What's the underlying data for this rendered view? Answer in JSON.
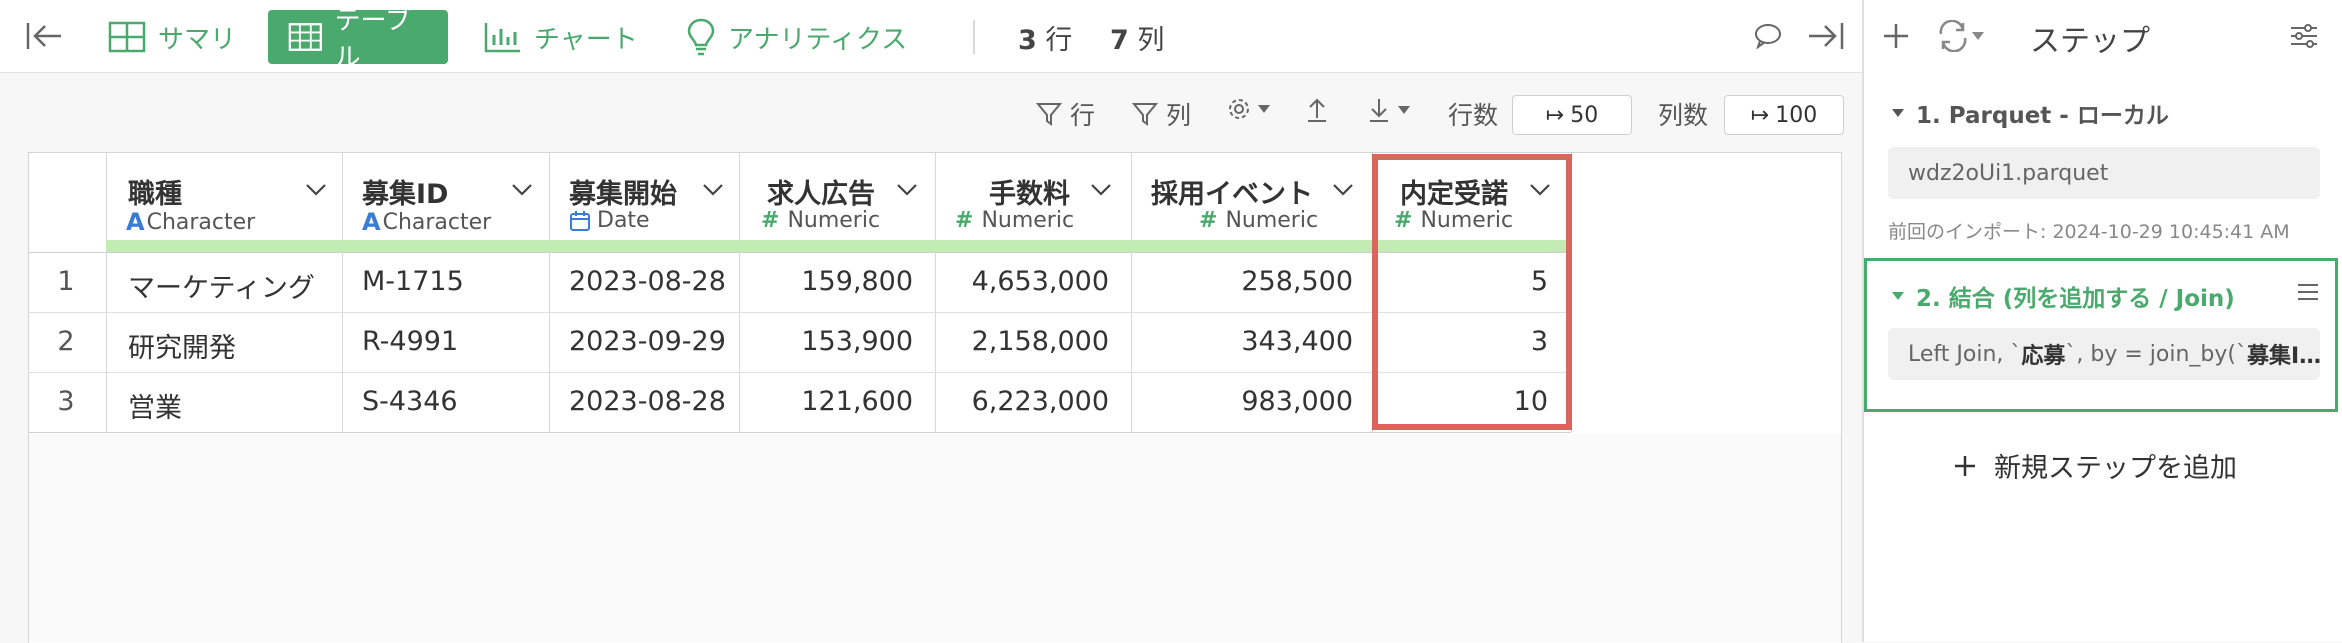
{
  "toolbar": {
    "summary_label": "サマリ",
    "table_label": "テーブル",
    "chart_label": "チャート",
    "analytics_label": "アナリティクス",
    "row_count": "3",
    "row_unit": "行",
    "col_count": "7",
    "col_unit": "列"
  },
  "subtoolbar": {
    "filter_rows": "行",
    "filter_cols": "列",
    "rows_label": "行数",
    "rows_value": "50",
    "cols_label": "列数",
    "cols_value": "100"
  },
  "columns": [
    {
      "name": "職種",
      "type": "Character",
      "type_icon": "character-icon"
    },
    {
      "name": "募集ID",
      "type": "Character",
      "type_icon": "character-icon"
    },
    {
      "name": "募集開始",
      "type": "Date",
      "type_icon": "calendar-icon"
    },
    {
      "name": "求人広告",
      "type": "Numeric",
      "type_icon": "hash-icon"
    },
    {
      "name": "手数料",
      "type": "Numeric",
      "type_icon": "hash-icon"
    },
    {
      "name": "採用イベント",
      "type": "Numeric",
      "type_icon": "hash-icon"
    },
    {
      "name": "内定受諾",
      "type": "Numeric",
      "type_icon": "hash-icon"
    }
  ],
  "rows": [
    {
      "n": "1",
      "c": [
        "マーケティング",
        "M-1715",
        "2023-08-28",
        "159,800",
        "4,653,000",
        "258,500",
        "5"
      ]
    },
    {
      "n": "2",
      "c": [
        "研究開発",
        "R-4991",
        "2023-09-29",
        "153,900",
        "2,158,000",
        "343,400",
        "3"
      ]
    },
    {
      "n": "3",
      "c": [
        "営業",
        "S-4346",
        "2023-08-28",
        "121,600",
        "6,223,000",
        "983,000",
        "10"
      ]
    }
  ],
  "panel": {
    "title": "ステップ",
    "step1": {
      "title": "1. Parquet - ローカル",
      "file": "wdz2oUi1.parquet",
      "meta": "前回のインポート: 2024-10-29 10:45:41 AM"
    },
    "step2": {
      "title": "2. 結合 (列を追加する / Join)",
      "code_prefix": "Left Join, `",
      "code_bold1": "応募",
      "code_mid": "`, by = join_by(`",
      "code_bold2": "募集I…"
    },
    "add_step": "新規ステップを追加"
  },
  "colors": {
    "accent": "#4aa96c",
    "highlight": "#d9655c",
    "type_bar": "#c2ecb4",
    "character_icon": "#3a7bd5"
  }
}
